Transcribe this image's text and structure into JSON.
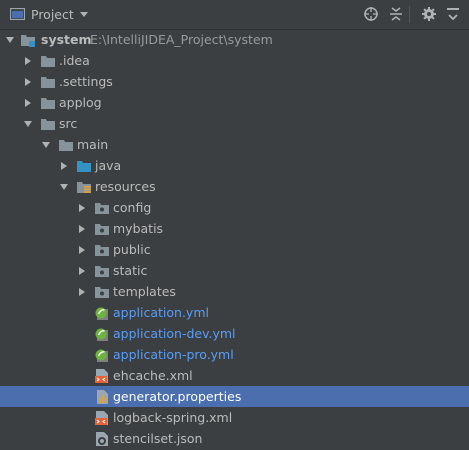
{
  "header": {
    "title": "Project",
    "icons": [
      "project-window-icon",
      "dropdown-arrow-icon",
      "locate-icon",
      "collapse-all-icon",
      "settings-gear-icon",
      "hide-icon"
    ]
  },
  "tree": {
    "root": {
      "name": "system",
      "path": "E:\\IntelliJIDEA_Project\\system"
    },
    "idea": ".idea",
    "settings": ".settings",
    "applog": "applog",
    "src": "src",
    "main": "main",
    "java": "java",
    "resources": "resources",
    "config": "config",
    "mybatis": "mybatis",
    "public": "public",
    "static": "static",
    "templates": "templates",
    "application_yml": "application.yml",
    "application_dev_yml": "application-dev.yml",
    "application_pro_yml": "application-pro.yml",
    "ehcache_xml": "ehcache.xml",
    "generator_properties": "generator.properties",
    "logback_xml": "logback-spring.xml",
    "stencilset_json": "stencilset.json"
  },
  "colors": {
    "background": "#3c3f41",
    "selection": "#4b6eaf",
    "config_file_text": "#589df6",
    "folder": "#87939a",
    "source_folder": "#3592c4"
  }
}
